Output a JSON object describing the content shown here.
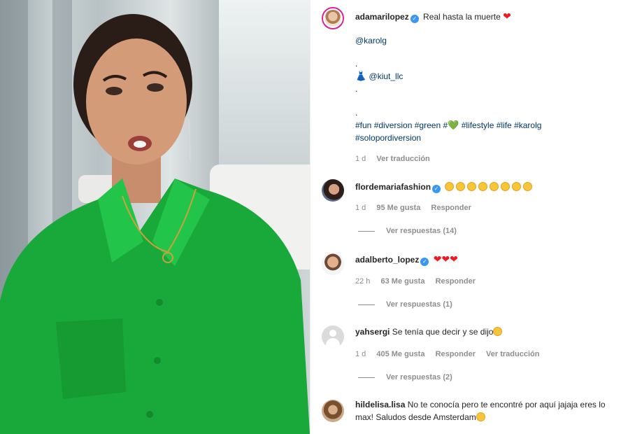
{
  "post": {
    "author": "adamarilopez",
    "caption": "Real hasta la muerte",
    "mention1": "@karolg",
    "dot1": ".",
    "dress_icon": "red-dress-icon",
    "mention2": "@kiut_llc",
    "dot2": ".",
    "dot3": ".",
    "hashtags_line1": [
      "#fun",
      "#diversion",
      "#green",
      "#"
    ],
    "hashtags_line1b": [
      "#lifestyle",
      "#life",
      "#karolg"
    ],
    "hashtags_line2": "#solopordiversion",
    "time": "1 d",
    "translate": "Ver traducción"
  },
  "comments": [
    {
      "user": "flordemariafashion",
      "verified": true,
      "text": "",
      "emoji_count": 8,
      "time": "1 d",
      "likes": "95 Me gusta",
      "reply": "Responder",
      "replies": "Ver respuestas (14)"
    },
    {
      "user": "adalberto_lopez",
      "verified": true,
      "text": "",
      "hearts": 3,
      "time": "22 h",
      "likes": "63 Me gusta",
      "reply": "Responder",
      "replies": "Ver respuestas (1)"
    },
    {
      "user": "yahsergi",
      "verified": false,
      "text": "Se tenía que decir y se dijo",
      "time": "1 d",
      "likes": "405 Me gusta",
      "reply": "Responder",
      "translate": "Ver traducción",
      "replies": "Ver respuestas (2)"
    },
    {
      "user": "hildelisa.lisa",
      "verified": false,
      "text": "No te conocía pero te encontré por aquí jajaja eres lo max! Saludos desde Amsterdam"
    }
  ],
  "colors": {
    "accent_link": "#00376b",
    "verified": "#3897f0",
    "heart": "#ed1c24",
    "shirt": "#19a83a"
  }
}
